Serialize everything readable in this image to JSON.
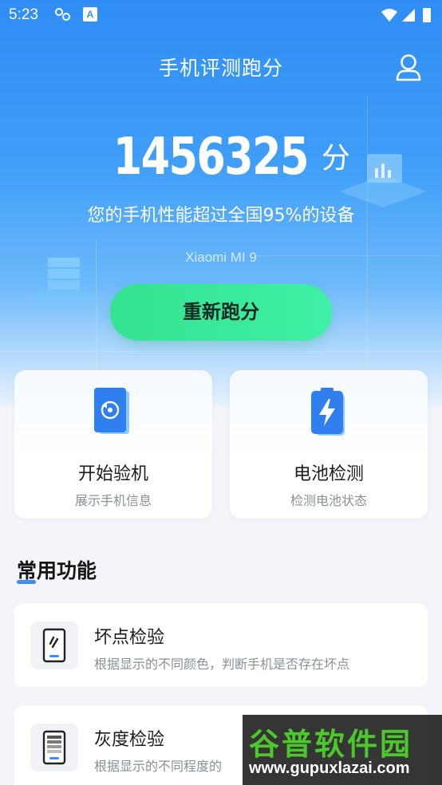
{
  "status_bar": {
    "time": "5:23",
    "notif_letter": "A"
  },
  "header": {
    "title": "手机评测跑分"
  },
  "score": {
    "value": "1456325",
    "unit": "分",
    "description": "您的手机性能超过全国95%的设备",
    "device": "Xiaomi MI 9"
  },
  "rescore_button": "重新跑分",
  "cards": [
    {
      "title": "开始验机",
      "subtitle": "展示手机信息",
      "icon": "rotate-phone-icon"
    },
    {
      "title": "电池检测",
      "subtitle": "检测电池状态",
      "icon": "battery-charge-icon"
    }
  ],
  "section": {
    "title": "常用功能"
  },
  "functions": [
    {
      "title": "坏点检验",
      "desc": "根据显示的不同颜色，判断手机是否存在坏点",
      "icon": "dead-pixel-icon"
    },
    {
      "title": "灰度检验",
      "desc": "根据显示的不同程度的",
      "icon": "grayscale-icon"
    }
  ],
  "watermark": {
    "logo": "谷普软件园",
    "url": "www.gupuxlazai.com"
  },
  "colors": {
    "primary": "#3b8ef5",
    "button_green": "#3ef0a6",
    "watermark_green": "#4cc72c"
  }
}
